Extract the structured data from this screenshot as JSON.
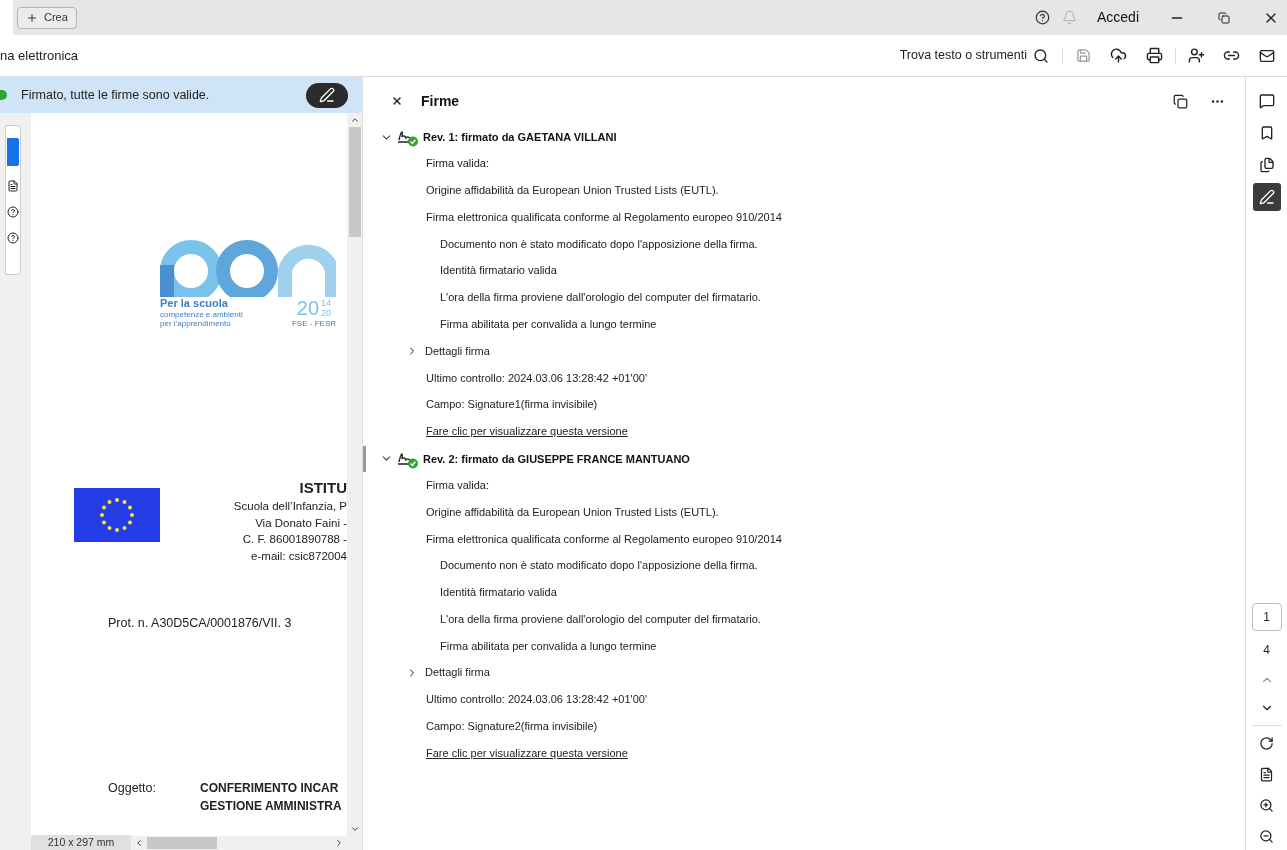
{
  "titlebar": {
    "create_button": "Crea",
    "account": "Accedi"
  },
  "toolbar": {
    "doc_title": "na elettronica",
    "search": "Trova testo o strumenti"
  },
  "banner": {
    "text": "Firmato, tutte le firme sono valide."
  },
  "document": {
    "logo": {
      "tagline": "Per la scuola",
      "sub1": "competenze e ambienti",
      "sub2": "per l’apprendimento",
      "year_a": "20",
      "year_b": "14",
      "year_c": "20",
      "fund": "FSE - FESR"
    },
    "header_title": "ISTITU",
    "header_lines": [
      "Scuola dell’Infanzia, P",
      "Via Donato Faini -",
      "C. F. 86001890788 -",
      "e-mail: csic872004"
    ],
    "protocol": "Prot. n. A30D5CA/0001876/VII. 3",
    "subject_label": "Oggetto:",
    "subject_lines": [
      "CONFERIMENTO INCAR",
      "GESTIONE AMMINISTRA"
    ],
    "page_size": "210 x 297 mm"
  },
  "panel": {
    "title": "Firme",
    "revisions": [
      {
        "title": "Rev. 1: firmato da GAETANA VILLANI",
        "expanded": true,
        "selected": false,
        "items": [
          {
            "text": "Firma valida:"
          },
          {
            "text": "Origine affidabilità da European Union Trusted Lists (EUTL)."
          },
          {
            "text": "Firma elettronica qualificata conforme al Regolamento europeo 910/2014",
            "children": [
              {
                "text": "Documento non è stato modificato dopo l'apposizione della firma."
              },
              {
                "text": "Identità firmatario valida"
              },
              {
                "text": "L'ora della firma proviene dall'orologio del computer del firmatario."
              },
              {
                "text": "Firma abilitata per convalida a lungo termine"
              }
            ]
          }
        ],
        "details": {
          "label": "Dettagli firma",
          "expanded": false
        },
        "last_check": "Ultimo controllo: 2024.03.06 13:28:42 +01'00'",
        "field": "Campo: Signature1(firma invisibile)",
        "link": "Fare clic per visualizzare questa versione"
      },
      {
        "title": "Rev. 2: firmato da GIUSEPPE FRANCE MANTUANO",
        "expanded": true,
        "selected": true,
        "items": [
          {
            "text": "Firma valida:"
          },
          {
            "text": "Origine affidabilità da European Union Trusted Lists (EUTL)."
          },
          {
            "text": "Firma elettronica qualificata conforme al Regolamento europeo 910/2014",
            "children": [
              {
                "text": "Documento non è stato modificato dopo l'apposizione della firma."
              },
              {
                "text": "Identità firmatario valida"
              },
              {
                "text": "L'ora della firma proviene dall'orologio del computer del firmatario."
              },
              {
                "text": "Firma abilitata per convalida a lungo termine"
              }
            ]
          }
        ],
        "details": {
          "label": "Dettagli firma",
          "expanded": false
        },
        "last_check": "Ultimo controllo: 2024.03.06 13:28:42 +01'00'",
        "field": "Campo: Signature2(firma invisibile)",
        "link": "Fare clic per visualizzare questa versione"
      }
    ]
  },
  "rail": {
    "tools": [
      {
        "kind": "comment",
        "selected": false
      },
      {
        "kind": "bookmark",
        "selected": false
      },
      {
        "kind": "pages",
        "selected": false
      },
      {
        "kind": "signature",
        "selected": true
      }
    ],
    "page_current": "1",
    "page_total": "4"
  }
}
